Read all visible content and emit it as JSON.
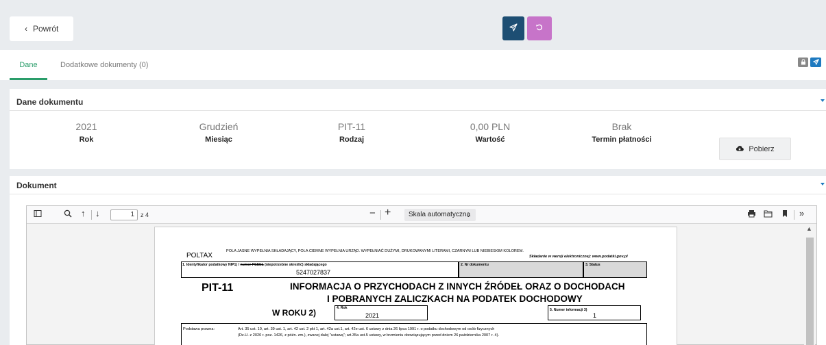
{
  "topbar": {
    "back_label": "Powrót",
    "back_icon": "chevron-left-icon",
    "send_icon": "paper-plane-icon",
    "undo_icon": "undo-icon",
    "colors": {
      "send": "#1d4e73",
      "undo": "#c774c9"
    }
  },
  "tabs": [
    {
      "label": "Dane",
      "active": true
    },
    {
      "label": "Dodatkowe dokumenty (0)",
      "active": false
    }
  ],
  "tab_actions": {
    "lock_icon": "lock-icon",
    "send_icon": "paper-plane-icon"
  },
  "document_details": {
    "title": "Dane dokumentu",
    "fields": [
      {
        "value": "2021",
        "label": "Rok"
      },
      {
        "value": "Grudzień",
        "label": "Miesiąc"
      },
      {
        "value": "PIT-11",
        "label": "Rodzaj"
      },
      {
        "value": "0,00 PLN",
        "label": "Wartość"
      },
      {
        "value": "Brak",
        "label": "Termin płatności"
      }
    ],
    "download_label": "Pobierz",
    "download_icon": "cloud-download-icon"
  },
  "document": {
    "title": "Dokument",
    "viewer": {
      "page_current": "1",
      "page_total": "z 4",
      "zoom": "Skala automatyczna"
    },
    "pdf": {
      "brand": "POLTAX",
      "instructions": "POLA JASNE WYPEŁNIA SKŁADAJĄCY, POLA CIEMNE WYPEŁNIA URZĄD. WYPEŁNIAĆ DUŻYMI, DRUKOWANYMI LITERAMI, CZARNYM LUB NIEBIESKIM KOLOREM.",
      "electronic_note": "Składanie w wersji elektronicznej: www.podatki.gov.pl",
      "field1_label_a": "1. Identyfikator podatkowy NIP1) / ",
      "field1_label_strike": "numer PESEL",
      "field1_label_b": " (niepotrzebne skreślić) składającego",
      "field1_value": "5247027837",
      "field2_label": "2. Nr dokumentu",
      "field3_label": "3. Status",
      "form_code": "PIT-11",
      "heading_line1": "INFORMACJA O PRZYCHODACH Z INNYCH ŹRÓDEŁ ORAZ O DOCHODACH",
      "heading_line2": "I POBRANYCH ZALICZKACH NA PODATEK DOCHODOWY",
      "year_label": "W ROKU 2)",
      "field4_label": "4. Rok",
      "field4_value": "2021",
      "field5_label": "5. Numer informacji 3)",
      "field5_value": "1",
      "legal_label": "Podstawa prawna:",
      "legal_line1": "Art. 35 ust. 10, art. 39 ust. 1, art. 42 ust. 2 pkt 1, art. 42a ust.1, art. 42e ust. 6 ustawy z dnia 26 lipca 1991 r. o podatku dochodowym od osób fizycznych",
      "legal_line2": "(Dz.U. z 2020 r. poz. 1426, z późn. zm.), zwanej dalej \"ustawą\"; art.35a ust.5 ustawy, w brzmieniu obowiązującym przed dniem 26 października 2007 r. 4)."
    }
  }
}
